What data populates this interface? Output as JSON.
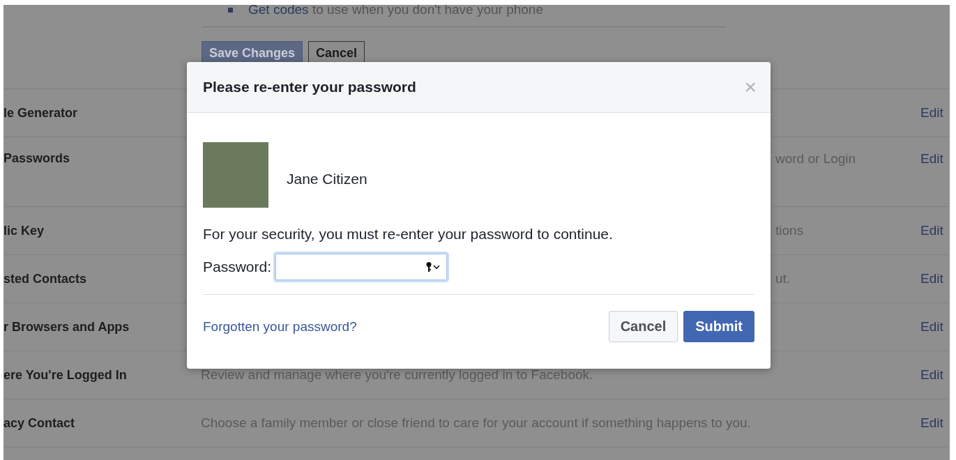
{
  "top_section": {
    "bullet_link": "Get codes",
    "bullet_text": "to use when you don't have your phone",
    "buttons": [
      {
        "label": "Save Changes",
        "disabled": true
      },
      {
        "label": "Cancel",
        "disabled": false
      }
    ]
  },
  "settings_rows": [
    {
      "label": "le Generator",
      "action": "Edit"
    },
    {
      "label": "Passwords",
      "description_right": "word or Login",
      "action": "Edit"
    },
    {
      "label": "lic Key",
      "description_right": "tions",
      "action": "Edit"
    },
    {
      "label": "sted Contacts",
      "description_right": "ut.",
      "action": "Edit"
    },
    {
      "label": "r Browsers and Apps",
      "action": "Edit"
    },
    {
      "label": "ere You're Logged In",
      "description": "Review and manage where you're currently logged in to Facebook.",
      "action": "Edit"
    },
    {
      "label": "acy Contact",
      "description": "Choose a family member or close friend to care for your account if something happens to you.",
      "action": "Edit"
    }
  ],
  "dialog": {
    "title": "Please re-enter your password",
    "close": "×",
    "user_name": "Jane Citizen",
    "message": "For your security, you must re-enter your password to continue.",
    "password_label": "Password:",
    "forgot_link": "Forgotten your password?",
    "buttons": [
      {
        "label": "Cancel",
        "kind": "secondary"
      },
      {
        "label": "Submit",
        "kind": "primary"
      }
    ]
  }
}
